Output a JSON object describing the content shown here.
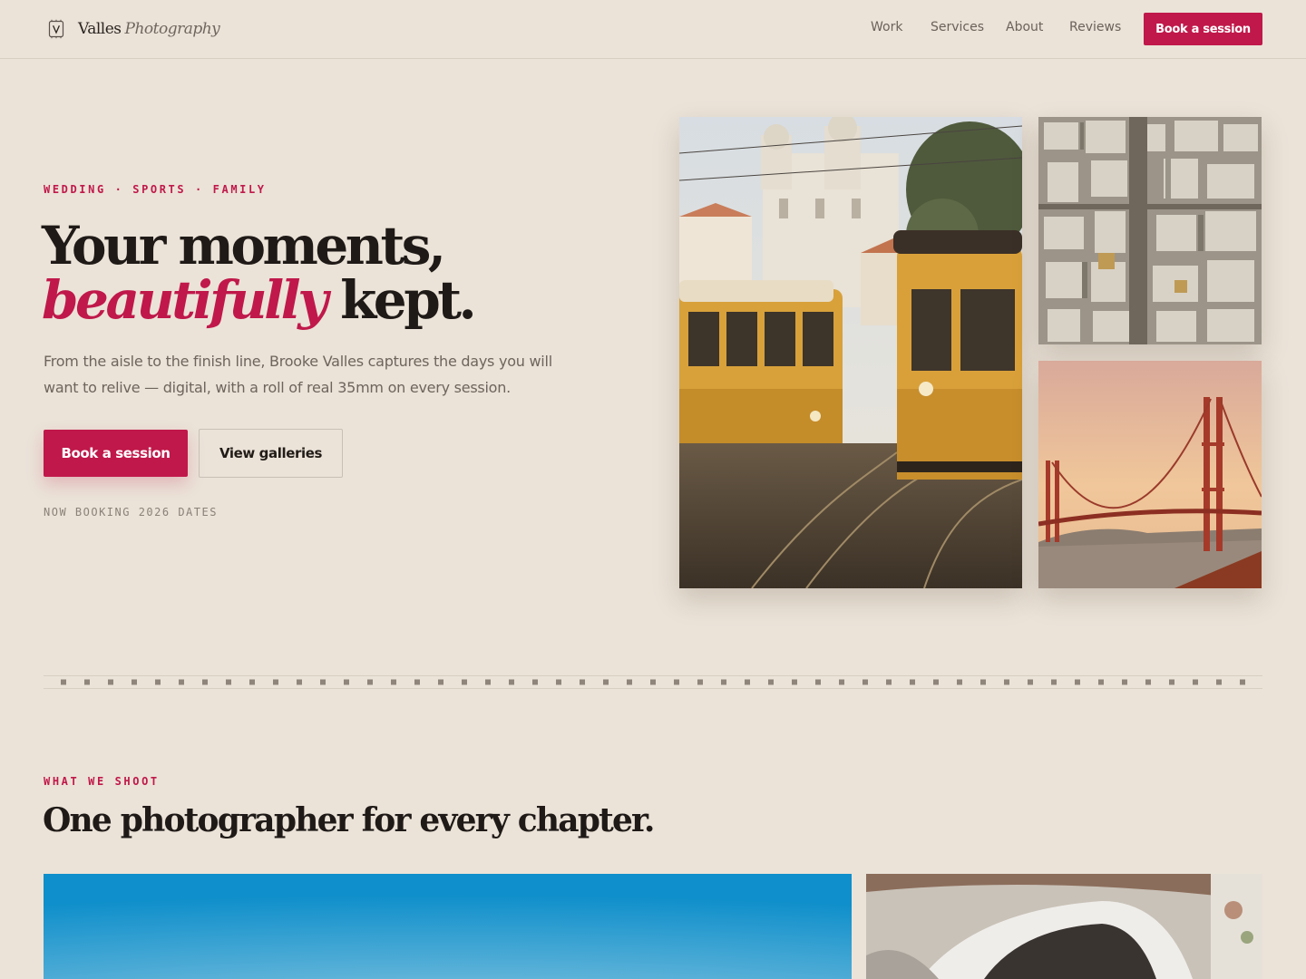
{
  "brand": {
    "name": "Valles",
    "name_italic": "Photography",
    "logo_icon": "v-monogram-icon"
  },
  "nav": {
    "links": [
      "Work",
      "Services",
      "About",
      "Reviews"
    ],
    "cta": "Book a session"
  },
  "hero": {
    "eyebrow": "WEDDING · SPORTS · FAMILY",
    "headline_line1": "Your moments,",
    "headline_accent": "beautifully",
    "headline_rest": "kept.",
    "subtext": "From the aisle to the finish line, Brooke Valles captures the days you will want to relive — digital, with a roll of real 35mm on every session.",
    "primary_cta": "Book a session",
    "secondary_cta": "View galleries",
    "note": "NOW BOOKING 2026 DATES"
  },
  "colors": {
    "accent": "#c0184a",
    "background": "#ebe3d8",
    "text": "#1f1a17",
    "muted": "#6e655d"
  },
  "section": {
    "eyebrow": "WHAT WE SHOOT",
    "title": "One photographer for every chapter."
  }
}
